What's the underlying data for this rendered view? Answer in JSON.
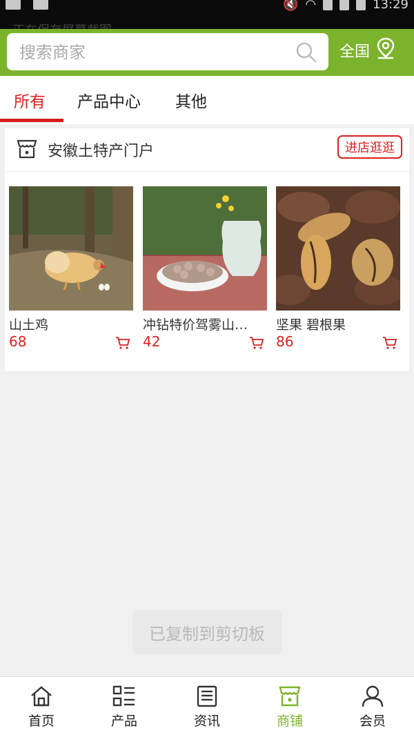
{
  "status_bar": {
    "time": "13:29",
    "overlay_text": "正在保存屏幕截图..."
  },
  "header": {
    "search_placeholder": "搜索商家",
    "region_label": "全国"
  },
  "tabs": [
    {
      "label": "所有",
      "active": true
    },
    {
      "label": "产品中心",
      "active": false
    },
    {
      "label": "其他",
      "active": false
    }
  ],
  "shop": {
    "name": "安徽土特产门户",
    "visit_button": "进店逛逛",
    "products": [
      {
        "name": "山土鸡",
        "price": "68",
        "image": "chicken-photo"
      },
      {
        "name": "冲钻特价驾雾山…",
        "price": "42",
        "image": "beans-photo"
      },
      {
        "name": "坚果 碧根果",
        "price": "86",
        "image": "pecan-photo"
      }
    ]
  },
  "toast": "已复制到剪切板",
  "bottom_nav": [
    {
      "label": "首页",
      "icon": "home-icon",
      "active": false
    },
    {
      "label": "产品",
      "icon": "grid-list-icon",
      "active": false
    },
    {
      "label": "资讯",
      "icon": "news-icon",
      "active": false
    },
    {
      "label": "商铺",
      "icon": "store-icon",
      "active": true
    },
    {
      "label": "会员",
      "icon": "user-icon",
      "active": false
    }
  ],
  "colors": {
    "brand_green": "#7cb32c",
    "accent_red": "#d81e1e",
    "price_red": "#e02020"
  }
}
